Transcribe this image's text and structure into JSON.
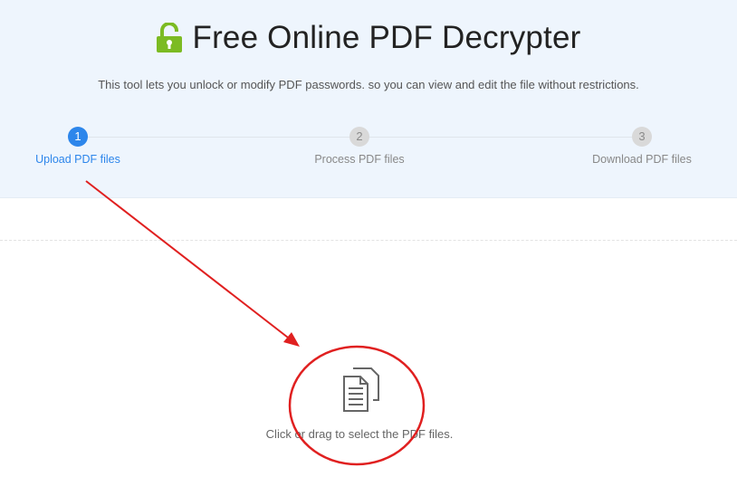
{
  "header": {
    "title": "Free Online PDF Decrypter",
    "subtitle": "This tool lets you unlock or modify PDF passwords. so you can view and edit the file without restrictions.",
    "icon": "unlock-icon",
    "icon_color": "#7cbb22"
  },
  "steps": [
    {
      "number": "1",
      "label": "Upload PDF files",
      "active": true
    },
    {
      "number": "2",
      "label": "Process PDF files",
      "active": false
    },
    {
      "number": "3",
      "label": "Download PDF files",
      "active": false
    }
  ],
  "upload": {
    "icon": "document-icon",
    "text": "Click or drag to select the PDF files."
  },
  "colors": {
    "accent": "#2d86eb",
    "header_bg": "#eef5fd",
    "annotation": "#e02020"
  }
}
